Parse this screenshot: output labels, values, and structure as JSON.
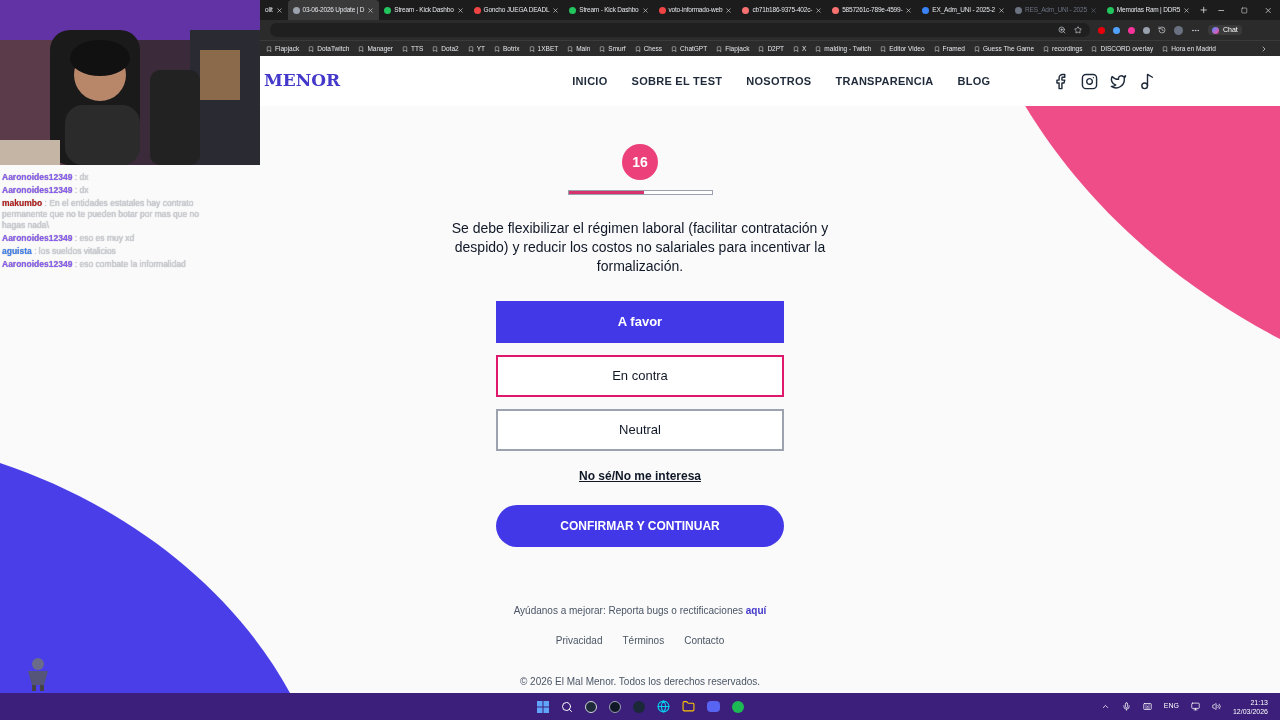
{
  "browser": {
    "tabs": [
      {
        "label": "olit",
        "selected": false
      },
      {
        "label": "03-06-2026 Update | D",
        "selected": true
      },
      {
        "label": "Stream - Kick Dashbo",
        "selected": false
      },
      {
        "label": "Goncho JUEGA DEADL",
        "selected": false
      },
      {
        "label": "Stream - Kick Dashbo",
        "selected": false
      },
      {
        "label": "voto-informado-web",
        "selected": false
      },
      {
        "label": "cb71b186-9375-402c-",
        "selected": false
      },
      {
        "label": "5857261c-789e-4599-",
        "selected": false
      },
      {
        "label": "EX_Adm_UNI - 2025-2",
        "selected": false
      },
      {
        "label": "RES_Adm_UNI - 2025",
        "selected": false
      },
      {
        "label": "Memorias Ram | DDR5",
        "selected": false
      }
    ],
    "copilot_label": "Chat",
    "bookmarks": [
      "Flapjack",
      "DotaTwitch",
      "Manager",
      "TTS",
      "Dota2",
      "YT",
      "Botrix",
      "1XBET",
      "Main",
      "Smurf",
      "Chess",
      "ChatGPT",
      "Flapjack",
      "D2PT",
      "X",
      "malding - Twitch",
      "Editor Video",
      "Framed",
      "Guess The Game",
      "recordings",
      "DISCORD overlay",
      "Hora en Madrid"
    ]
  },
  "site": {
    "logo": "MENOR",
    "nav": [
      "INICIO",
      "SOBRE EL TEST",
      "NOSOTROS",
      "TRANSPARENCIA",
      "BLOG"
    ],
    "step": "16",
    "progress": {
      "level": 0.53
    },
    "question": "Se debe flexibilizar el régimen laboral (facilitar contratación y despido) y reducir los costos no salariales para incentivar la formalización.",
    "options": [
      {
        "label": "A favor",
        "selected": true,
        "color": "#4338e8"
      },
      {
        "label": "En contra",
        "selected": false,
        "color": "#e0186c"
      },
      {
        "label": "Neutral",
        "selected": false,
        "color": "#9ca3af"
      }
    ],
    "skip_link": "No sé/No me interesa",
    "confirm": "CONFIRMAR Y CONTINUAR",
    "footer": {
      "report": "Ayúdanos a mejorar: Reporta bugs o rectificaciones **aquí**",
      "links": [
        "Privacidad",
        "Términos",
        "Contacto"
      ],
      "copyright": "© 2026 El Mal Menor. Todos los derechos reservados."
    }
  },
  "chat": [
    {
      "user": "Aaronoides12349",
      "color": "#8b5cf6",
      "text": ": dx"
    },
    {
      "user": "Aaronoides12349",
      "color": "#8b5cf6",
      "text": ": dx"
    },
    {
      "user": "makumbo",
      "color": "#b91c1c",
      "text": ": En el entidades estatales hay contrato permanente que no te pueden botar por mas que no hagas nada\\"
    },
    {
      "user": "Aaronoides12349",
      "color": "#8b5cf6",
      "text": ": eso es muy xd"
    },
    {
      "user": "aguista",
      "color": "#3b82f6",
      "text": ": los sueldos vitalicios"
    },
    {
      "user": "Aaronoides12349",
      "color": "#8b5cf6",
      "text": ": eso combate la informalidad"
    }
  ],
  "taskbar": {
    "language": "ENG",
    "time": "21:13",
    "date": "12/03/2026"
  }
}
